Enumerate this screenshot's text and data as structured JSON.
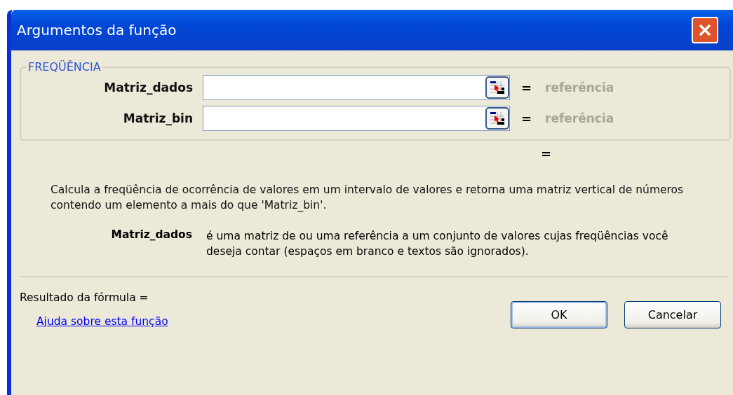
{
  "window": {
    "title": "Argumentos da função"
  },
  "function_group": {
    "legend": "FREQÜÊNCIA",
    "arguments": [
      {
        "label": "Matriz_dados",
        "equals": "=",
        "hint": "referência"
      },
      {
        "label": "Matriz_bin",
        "equals": "=",
        "hint": "referência"
      }
    ]
  },
  "function_result": {
    "equals": "="
  },
  "description": "Calcula a freqüência de ocorrência de valores em um intervalo de valores e retorna uma matriz vertical de números contendo um elemento a mais do que 'Matriz_bin'.",
  "argument_help": {
    "label": "Matriz_dados",
    "text": "é uma matriz de ou uma referência a um conjunto de valores cujas freqüências você deseja contar (espaços em branco e textos são ignorados)."
  },
  "formula_result": "Resultado da fórmula =",
  "help_link": "Ajuda sobre esta função",
  "buttons": [
    {
      "label": "OK",
      "default": true
    },
    {
      "label": "Cancelar",
      "default": false
    }
  ]
}
